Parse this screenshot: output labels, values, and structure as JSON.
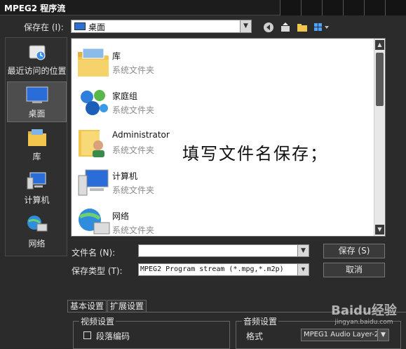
{
  "window": {
    "title": "MPEG2 程序流"
  },
  "save_in": {
    "label": "保存在 (I):",
    "value": "桌面"
  },
  "places": [
    {
      "label": "最近访问的位置",
      "icon": "recent-places-icon"
    },
    {
      "label": "桌面",
      "icon": "desktop-icon",
      "selected": true
    },
    {
      "label": "库",
      "icon": "library-icon"
    },
    {
      "label": "计算机",
      "icon": "computer-icon"
    },
    {
      "label": "网络",
      "icon": "network-icon"
    }
  ],
  "files": [
    {
      "name": "库",
      "type": "系统文件夹",
      "icon": "library-folder-icon"
    },
    {
      "name": "家庭组",
      "type": "系统文件夹",
      "icon": "homegroup-icon"
    },
    {
      "name": "Administrator",
      "type": "系统文件夹",
      "icon": "user-folder-icon"
    },
    {
      "name": "计算机",
      "type": "系统文件夹",
      "icon": "computer-icon"
    },
    {
      "name": "网络",
      "type": "系统文件夹",
      "icon": "network-icon"
    }
  ],
  "annotation": "填写文件名保存；",
  "filename": {
    "label": "文件名 (N):",
    "value": ""
  },
  "filetype": {
    "label": "保存类型 (T):",
    "value": "MPEG2 Program stream (*.mpg,*.m2p)"
  },
  "buttons": {
    "save": "保存 (S)",
    "cancel": "取消"
  },
  "tabs": [
    {
      "label": "基本设置",
      "active": true
    },
    {
      "label": "扩展设置"
    }
  ],
  "video": {
    "title": "视频设置",
    "segment_encode": "段落编码"
  },
  "audio": {
    "title": "音频设置",
    "format_label": "格式",
    "format_value": "MPEG1 Audio Layer-2"
  },
  "watermark": {
    "brand": "Baidu经验",
    "url": "jingyan.baidu.com"
  }
}
